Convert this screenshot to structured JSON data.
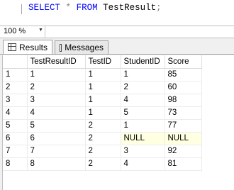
{
  "editor": {
    "query": {
      "keyword1": "SELECT",
      "star": "*",
      "keyword2": "FROM",
      "table": "TestResult",
      "semicolon": ";"
    }
  },
  "zoom": {
    "value": "100 %"
  },
  "tabs": [
    {
      "label": "Results",
      "active": true
    },
    {
      "label": "Messages",
      "active": false
    }
  ],
  "grid": {
    "columns": [
      "TestResultID",
      "TestID",
      "StudentID",
      "Score"
    ],
    "rows": [
      {
        "num": "1",
        "cells": [
          "1",
          "1",
          "1",
          "85"
        ]
      },
      {
        "num": "2",
        "cells": [
          "2",
          "1",
          "2",
          "60"
        ]
      },
      {
        "num": "3",
        "cells": [
          "3",
          "1",
          "4",
          "98"
        ]
      },
      {
        "num": "4",
        "cells": [
          "4",
          "1",
          "5",
          "73"
        ]
      },
      {
        "num": "5",
        "cells": [
          "5",
          "2",
          "1",
          "77"
        ]
      },
      {
        "num": "6",
        "cells": [
          "6",
          "2",
          "NULL",
          "NULL"
        ]
      },
      {
        "num": "7",
        "cells": [
          "7",
          "2",
          "3",
          "92"
        ]
      },
      {
        "num": "8",
        "cells": [
          "8",
          "2",
          "4",
          "81"
        ]
      }
    ]
  },
  "colors": {
    "keyword": "#0000ff",
    "operator": "#808080",
    "null_background": "#ffffe1"
  }
}
